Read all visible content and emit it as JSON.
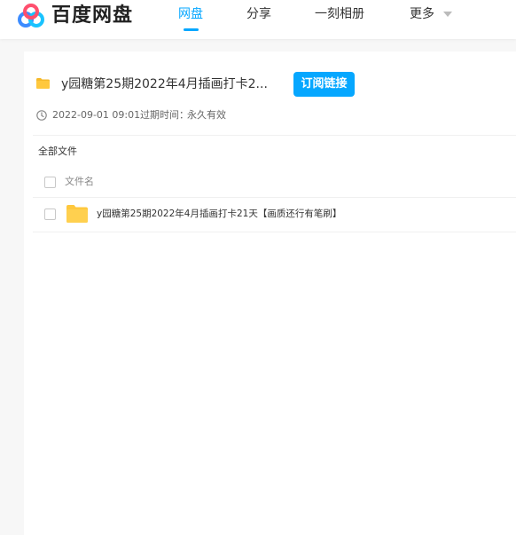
{
  "brand": {
    "name": "百度网盘"
  },
  "nav": {
    "items": [
      {
        "label": "网盘",
        "active": true
      },
      {
        "label": "分享",
        "active": false
      },
      {
        "label": "一刻相册",
        "active": false
      },
      {
        "label": "更多",
        "active": false
      }
    ]
  },
  "share": {
    "title": "y园糖第25期2022年4月插画打卡2...",
    "subscribe_label": "订阅链接",
    "date": "2022-09-01 09:01",
    "expire_label": "过期时间：",
    "expire_value": "永久有效"
  },
  "files": {
    "breadcrumb": "全部文件",
    "column_header": "文件名",
    "items": [
      {
        "name": "y园糖第25期2022年4月插画打卡21天【画质还行有笔刷】",
        "type": "folder"
      }
    ]
  },
  "colors": {
    "accent": "#06a7ff",
    "folder": "#ffd04f"
  }
}
